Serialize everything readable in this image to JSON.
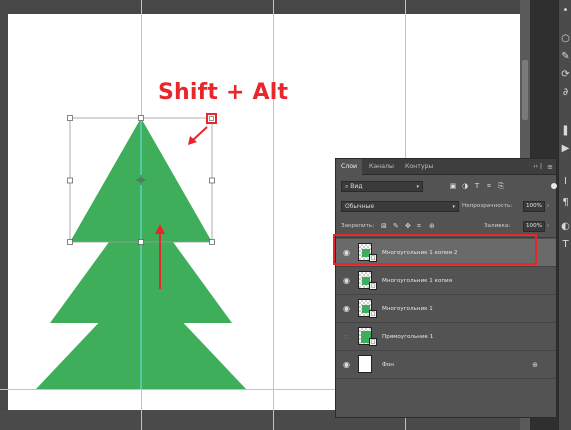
{
  "hint_text": "Shift + Alt",
  "colors": {
    "tree": "#3fae5a",
    "guide": "#6fe3f0",
    "accent_red": "#e8262b",
    "panel_bg": "#535353"
  },
  "layers_panel": {
    "tabs": [
      {
        "label": "Слои",
        "active": true
      },
      {
        "label": "Каналы",
        "active": false
      },
      {
        "label": "Контуры",
        "active": false
      }
    ],
    "tab_controls": "›› |",
    "menu_icon": "≡",
    "kind_filter": {
      "label": "Вид",
      "icon": "search-icon"
    },
    "blend_mode": "Обычные",
    "opacity_label": "Непрозрачность:",
    "opacity_value": "100%",
    "lock_label": "Закрепить:",
    "fill_label": "Заливка:",
    "fill_value": "100%",
    "layers": [
      {
        "name": "Многоугольник 1 копия 2",
        "visible": true,
        "selected": true,
        "thumb": "shape"
      },
      {
        "name": "Многоугольник 1 копия",
        "visible": true,
        "selected": false,
        "thumb": "shape"
      },
      {
        "name": "Многоугольник 1",
        "visible": true,
        "selected": false,
        "thumb": "shape"
      },
      {
        "name": "Прямоугольник 1",
        "visible": false,
        "selected": false,
        "thumb": "shape"
      },
      {
        "name": "Фон",
        "visible": true,
        "selected": false,
        "thumb": "white",
        "locked": true
      }
    ]
  }
}
